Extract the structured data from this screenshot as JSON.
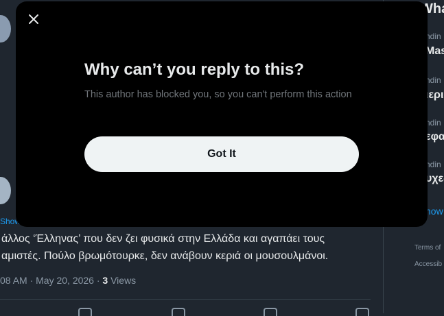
{
  "background": {
    "show_link": "Show",
    "tweet_line_1": "άλλος ‘Έλληνας’ που δεν ζει φυσικά στην Ελλάδα και αγαπάει τους",
    "tweet_line_2": "αμιστές. Πούλο βρωμότουρκε, δεν ανάβουν κεριά οι μουσουλμάνοι.",
    "meta_time": "08 AM · May 20, 2026 · ",
    "meta_views_count": "3",
    "meta_views_label": " Views"
  },
  "sidebar": {
    "header": "Wha",
    "items": [
      {
        "sub": "ndin",
        "title": "Mast"
      },
      {
        "sub": "ndin",
        "title": "ιερι"
      },
      {
        "sub": "ndin",
        "title": "εφα"
      },
      {
        "sub": "ndin",
        "title": "υχες"
      }
    ],
    "show_more": "how",
    "footer_1": "Terms of",
    "footer_2": "Accessib"
  },
  "modal": {
    "title": "Why can’t you reply to this?",
    "description": "This author has blocked you, so you can't perform this action",
    "button_label": "Got It"
  },
  "colors": {
    "modal_bg": "#000000",
    "button_bg": "#eff3f4",
    "accent": "#1d9bf0"
  }
}
